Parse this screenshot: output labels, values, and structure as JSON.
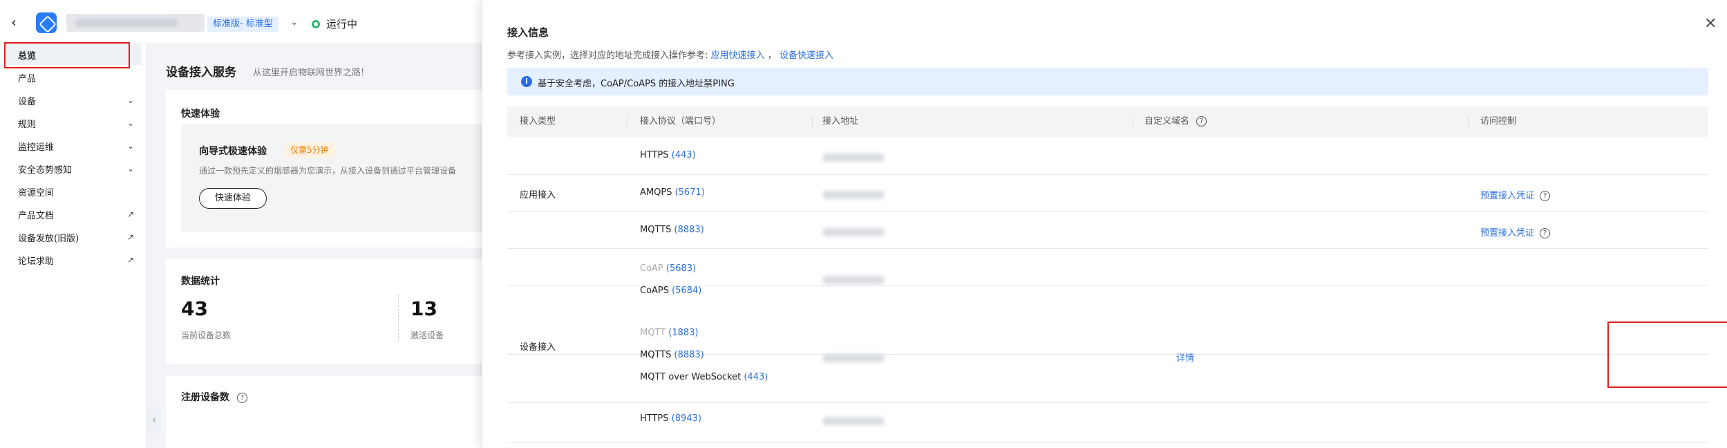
{
  "header": {
    "edition": "标准版- 标准型",
    "status": "运行中"
  },
  "sidebar": {
    "items": [
      {
        "label": "总览",
        "suffix": ""
      },
      {
        "label": "产品",
        "suffix": ""
      },
      {
        "label": "设备",
        "suffix": "chevron-down-icon"
      },
      {
        "label": "规则",
        "suffix": "chevron-down-icon"
      },
      {
        "label": "监控运维",
        "suffix": "chevron-down-icon"
      },
      {
        "label": "安全态势感知",
        "suffix": "chevron-down-icon"
      },
      {
        "label": "资源空间",
        "suffix": ""
      },
      {
        "label": "产品文档",
        "suffix": "external-link-icon"
      },
      {
        "label": "设备发放(旧版)",
        "suffix": "external-link-icon"
      },
      {
        "label": "论坛求助",
        "suffix": "external-link-icon"
      }
    ]
  },
  "main": {
    "title": "设备接入服务",
    "subtitle": "从这里开启物联网世界之路!",
    "quick": {
      "title": "快速体验",
      "guide_title": "向导式极速体验",
      "guide_badge": "仅需5分钟",
      "guide_desc": "通过一款预先定义的烟感器为您演示，从接入设备到通过平台管理设备",
      "button": "快速体验"
    },
    "stats": {
      "title": "数据统计",
      "items": [
        {
          "value": "43",
          "label": "当前设备总数"
        },
        {
          "value": "13",
          "label": "激活设备"
        }
      ]
    },
    "register": {
      "title": "注册设备数"
    }
  },
  "drawer": {
    "title": "接入信息",
    "desc_prefix": "参考接入实例，选择对应的地址完成接入操作参考:",
    "link_app": "应用快速接入",
    "desc_sep": "，",
    "link_device": "设备快速接入",
    "notice": "基于安全考虑，CoAP/CoAPS 的接入地址禁PING",
    "columns": [
      "接入类型",
      "接入协议（端口号）",
      "接入地址",
      "自定义域名",
      "访问控制"
    ],
    "groups": [
      {
        "type": "应用接入"
      },
      {
        "type": "设备接入"
      }
    ],
    "rows": [
      {
        "protocol": "HTTPS",
        "port": "(443)",
        "access": ""
      },
      {
        "protocol": "AMQPS",
        "port": "(5671)",
        "access": "预置接入凭证"
      },
      {
        "protocol": "MQTTS",
        "port": "(8883)",
        "access": "预置接入凭证"
      },
      {
        "protocol": "CoAP",
        "port": "(5683)",
        "access": ""
      },
      {
        "protocol": "CoAPS",
        "port": "(5684)",
        "access": ""
      },
      {
        "protocol": "MQTT",
        "port": "(1883)",
        "access": ""
      },
      {
        "protocol": "MQTTS",
        "port": "(8883)",
        "access": ""
      },
      {
        "protocol": "MQTT over WebSocket",
        "port": "(443)",
        "access": ""
      },
      {
        "protocol": "HTTPS",
        "port": "(8943)",
        "access": ""
      }
    ],
    "detail_link": "详情"
  },
  "colors": {
    "accent": "#2a6fe0",
    "annotation": "#e02020",
    "status_ok": "#2bb673"
  }
}
